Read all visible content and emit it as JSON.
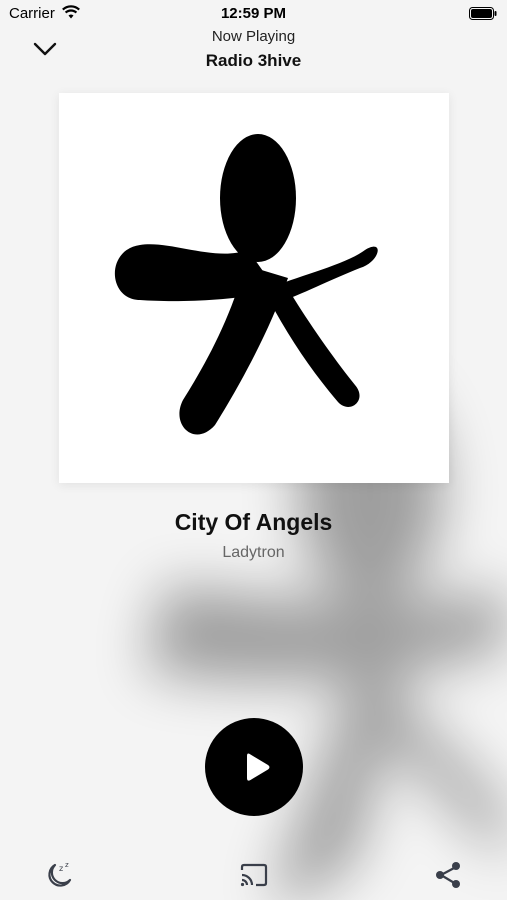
{
  "status_bar": {
    "carrier": "Carrier",
    "time": "12:59 PM"
  },
  "header": {
    "subtitle": "Now Playing",
    "station": "Radio 3hive"
  },
  "track": {
    "title": "City Of Angels",
    "artist": "Ladytron"
  },
  "controls": {
    "collapse_icon": "chevron-down-icon",
    "play_icon": "play-icon",
    "sleep_timer_icon": "sleep-moon-icon",
    "cast_icon": "cast-icon",
    "share_icon": "share-icon"
  },
  "colors": {
    "accent": "#000000",
    "background": "#f4f4f4",
    "artist_text": "#666666"
  }
}
